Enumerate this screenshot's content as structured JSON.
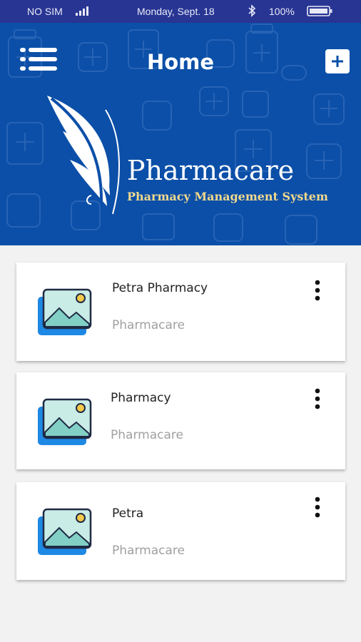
{
  "status_bar": {
    "carrier": "NO SIM",
    "date": "Monday, Sept. 18",
    "battery": "100%",
    "icons": [
      "signal-icon",
      "bluetooth-icon",
      "battery-icon"
    ]
  },
  "header": {
    "title": "Home",
    "menu_icon": "menu-list-icon",
    "add_icon": "plus-icon",
    "brand_name": "Pharmacare",
    "brand_tagline": "Pharmacy Management System",
    "background_color": "#0b4fa8",
    "tagline_color": "#f2d98c"
  },
  "pharmacies": [
    {
      "name": "Petra Pharmacy",
      "subtitle": "Pharmacare",
      "icon": "image-placeholder-icon"
    },
    {
      "name": "Pharmacy",
      "subtitle": "Pharmacare",
      "icon": "image-placeholder-icon"
    },
    {
      "name": "Petra",
      "subtitle": "Pharmacare",
      "icon": "image-placeholder-icon"
    }
  ],
  "card_more_icon": "more-vertical-icon"
}
